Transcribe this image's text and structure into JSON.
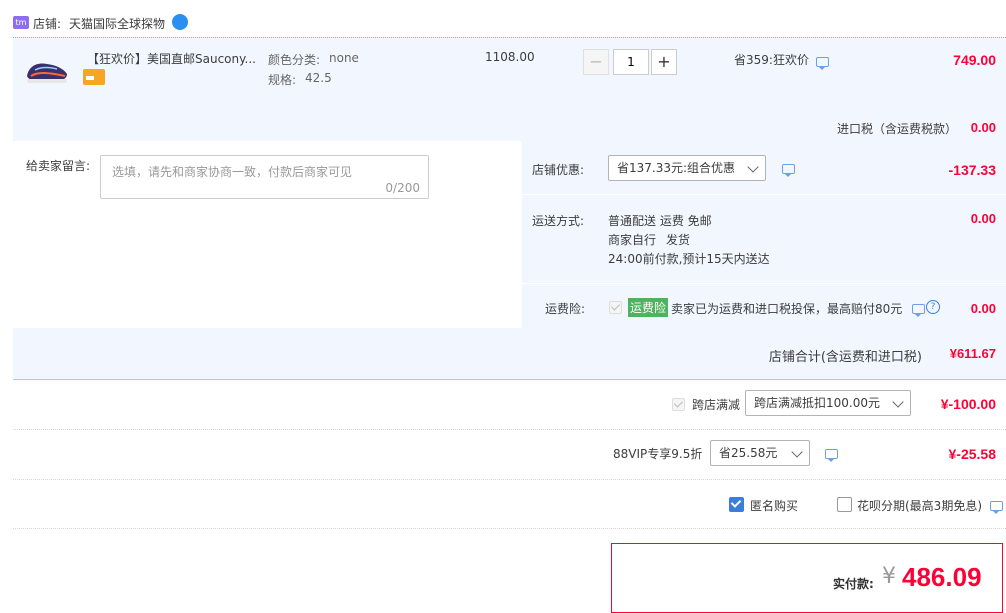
{
  "shop": {
    "prefix": "店铺:",
    "name": "天猫国际全球探物"
  },
  "item": {
    "title": "【狂欢价】美国直邮Saucony...",
    "color_label": "颜色分类:",
    "color_value": "none",
    "size_label": "规格:",
    "size_value": "42.5",
    "price": "1108.00",
    "quantity": "1",
    "minus": "−",
    "plus": "+",
    "promo": "省359:狂欢价",
    "subtotal": "749.00"
  },
  "import_tax": {
    "label": "进口税（含运费税款）",
    "value": "0.00"
  },
  "message": {
    "label": "给卖家留言:",
    "placeholder": "选填，请先和商家协商一致，付款后商家可见",
    "counter": "0/200"
  },
  "shop_discount": {
    "label": "店铺优惠:",
    "selected": "省137.33元:组合优惠",
    "value": "-137.33"
  },
  "shipping": {
    "label": "运送方式:",
    "line1": "普通配送 运费 免邮",
    "line2_a": "商家自行",
    "line2_b": "发货",
    "line3": "24:00前付款,预计15天内送达",
    "value": "0.00"
  },
  "insurance": {
    "label": "运费险:",
    "badge": "运费险",
    "text": "卖家已为运费和进口税投保，最高赔付80元",
    "value": "0.00"
  },
  "shop_total": {
    "label": "店铺合计(含运费和进口税)",
    "value": "¥611.67"
  },
  "cross_store": {
    "label": "跨店满减",
    "selected": "跨店满减抵扣100.00元",
    "value": "¥-100.00"
  },
  "vip": {
    "label": "88VIP专享9.5折",
    "selected": "省25.58元",
    "value": "¥-25.58"
  },
  "anonymous": {
    "label": "匿名购买",
    "checked": true
  },
  "huabei": {
    "label": "花呗分期(最高3期免息)",
    "checked": false
  },
  "pay": {
    "label": "实付款:",
    "currency": "¥",
    "value": "486.09"
  },
  "colors": {
    "accent_red": "#ff0036",
    "light_blue_bg": "#f2f7ff",
    "checkbox_blue": "#3b7ddd",
    "insurance_green": "#4cb45c"
  }
}
